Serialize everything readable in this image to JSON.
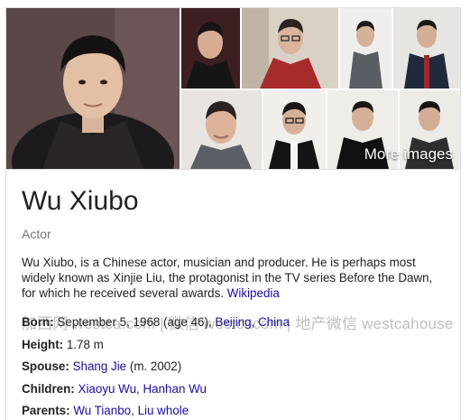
{
  "name": "Wu Xiubo",
  "occupation": "Actor",
  "description": "Wu Xiubo, is a Chinese actor, musician and producer. He is perhaps most widely known as Xinjie Liu, the protagonist in the TV series Before the Dawn, for which he received several awards.",
  "source_link": "Wikipedia",
  "more_images": "More images",
  "facts": {
    "born": {
      "label": "Born:",
      "date": "September 5, 1968 (age 46),",
      "place": "Beijing, China"
    },
    "height": {
      "label": "Height:",
      "value": "1.78 m"
    },
    "spouse": {
      "label": "Spouse:",
      "name": "Shang Jie",
      "note": "(m. 2002)"
    },
    "children": {
      "label": "Children:",
      "first": "Xiaoyu Wu",
      "second": "Hanhan Wu",
      "sep": ", "
    },
    "parents": {
      "label": "Parents:",
      "first": "Wu Tianbo",
      "second": "Liu whole",
      "sep": ", "
    }
  },
  "watermark": "加西网 westca.com | 微信 westcacom | 地产微信 westcahouse",
  "colors": {
    "link": "#1a0dab",
    "muted": "#777777",
    "border": "#dddddd"
  }
}
